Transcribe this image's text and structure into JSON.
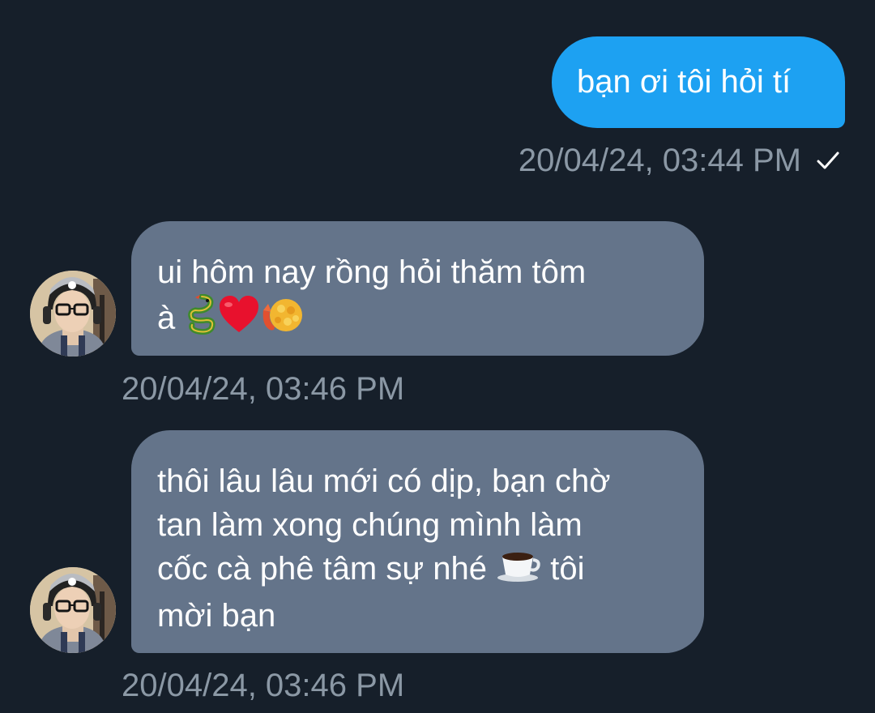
{
  "messages": [
    {
      "direction": "outgoing",
      "text": "bạn ơi tôi hỏi tí",
      "timestamp": "20/04/24, 03:44 PM",
      "status_icon": "check-icon",
      "bubble_color": "#1da1f2"
    },
    {
      "direction": "incoming",
      "text": "ui hôm nay rồng hỏi thăm tôm\nà",
      "emojis": [
        "dragon-emoji",
        "red-heart-emoji",
        "fried-shrimp-emoji"
      ],
      "timestamp": "20/04/24, 03:46 PM",
      "bubble_color": "#64748a"
    },
    {
      "direction": "incoming",
      "text_before_emoji": "thôi lâu lâu mới có dịp, bạn chờ\ntan làm xong chúng mình làm\ncốc cà phê tâm sự nhé ",
      "emoji": "coffee-cup-emoji",
      "text_after_emoji": " tôi\nmời bạn",
      "timestamp": "20/04/24, 03:46 PM",
      "bubble_color": "#64748a"
    }
  ],
  "colors": {
    "background": "#161f2a",
    "outgoing_bubble": "#1da1f2",
    "incoming_bubble": "#64748a",
    "timestamp_text": "#8b98a5",
    "message_text": "#ffffff"
  }
}
